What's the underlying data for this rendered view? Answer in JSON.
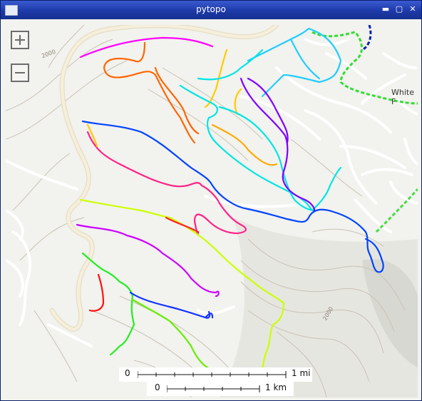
{
  "window": {
    "title": "pytopo",
    "controls": {
      "minimize": "▬",
      "maximize": "▢",
      "close": "✕"
    }
  },
  "map": {
    "place_label": "White F",
    "contour_labels": [
      "2000",
      "2000"
    ],
    "scales": [
      {
        "zero": "0",
        "end_label": "1 mi"
      },
      {
        "zero": "0",
        "end_label": "1 km"
      }
    ],
    "track_colors": [
      "#ff00ff",
      "#ff6600",
      "#ffcc00",
      "#22ccff",
      "#00e5e5",
      "#7f00ff",
      "#0044ff",
      "#ff2288",
      "#ccff00",
      "#22ee22",
      "#1133ff",
      "#ff1111",
      "#22dd44"
    ]
  }
}
